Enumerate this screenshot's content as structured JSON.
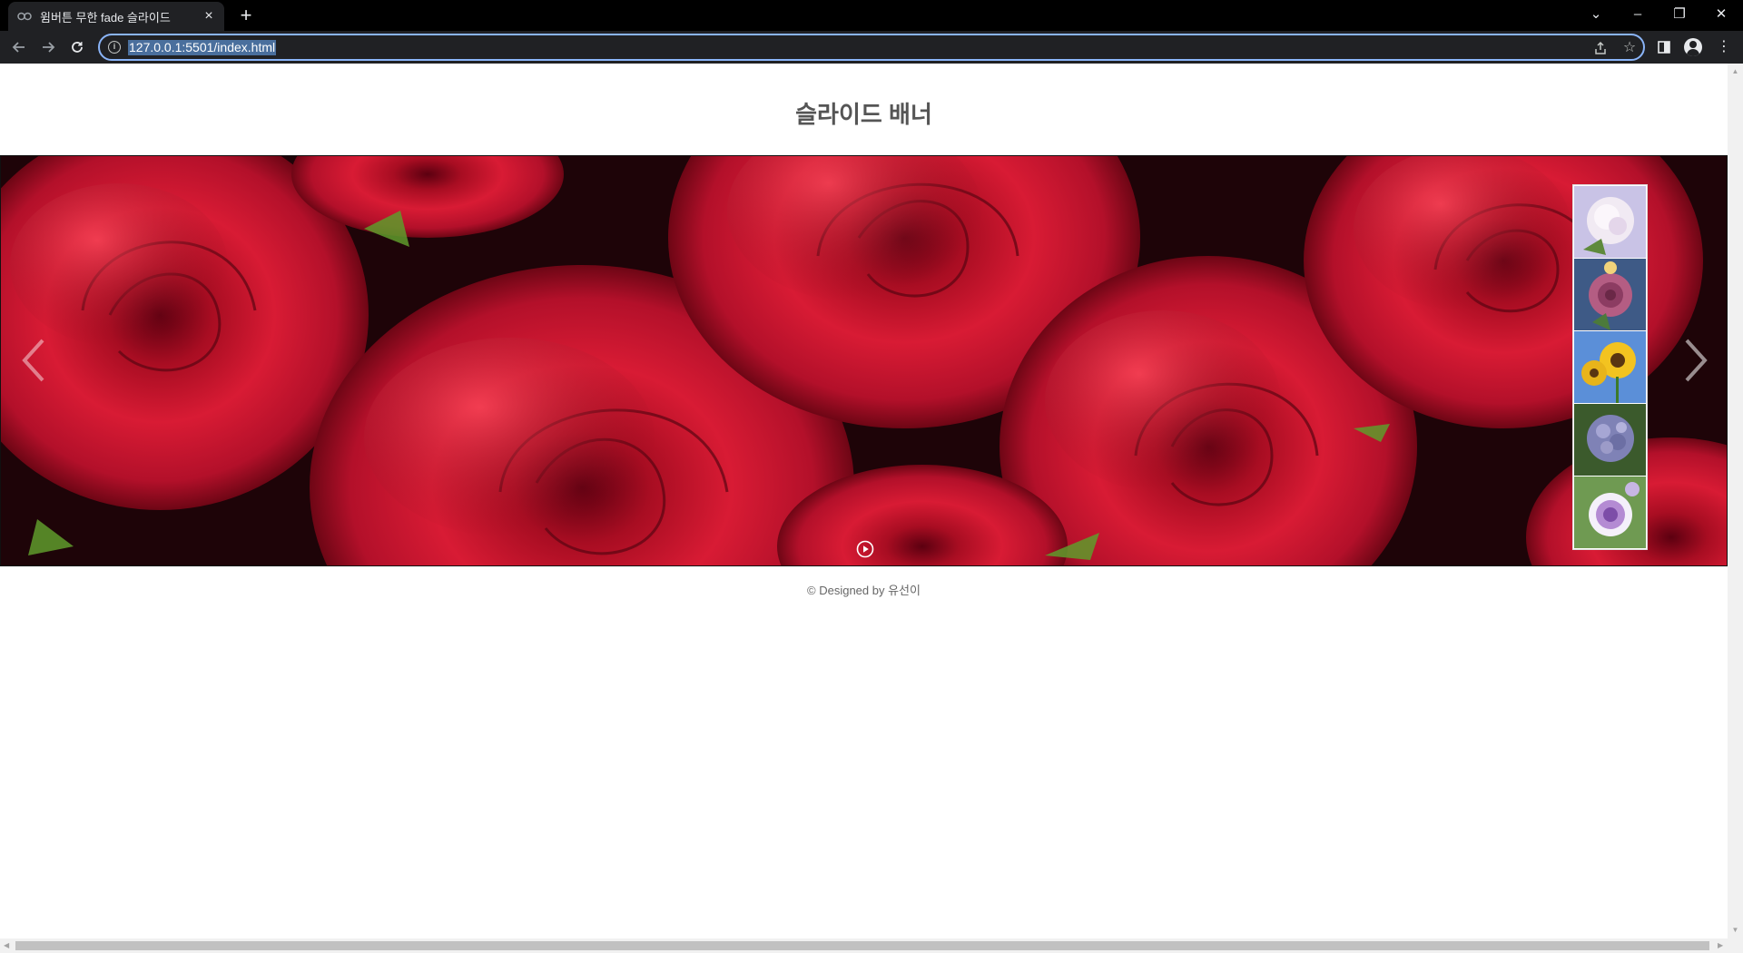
{
  "browser": {
    "tab_title": "윔버튼 무한 fade 슬라이드",
    "tab_close": "×",
    "new_tab": "+",
    "url": "127.0.0.1:5501/index.html",
    "window_controls": {
      "dropdown": "⌄",
      "minimize": "–",
      "restore": "❐",
      "close": "✕"
    }
  },
  "page": {
    "title": "슬라이드 배너",
    "footer": "© Designed by 유선이"
  },
  "slider": {
    "current_slide": "red-roses",
    "prev_icon": "chevron-left-icon",
    "next_icon": "chevron-right-icon",
    "play_icon": "play-circle-icon",
    "thumbnails": [
      {
        "name": "white-peony",
        "color": "#d9cfe6"
      },
      {
        "name": "pink-rose",
        "color": "#b45d83"
      },
      {
        "name": "sunflower",
        "color": "#f3c320"
      },
      {
        "name": "purple-hydrangea",
        "color": "#7f82b6"
      },
      {
        "name": "purple-lisianthus",
        "color": "#b48bd3"
      }
    ]
  },
  "colors": {
    "accent_focus": "#8ab4f8",
    "chrome_dark": "#202124",
    "rose_red": "#c8102e"
  }
}
